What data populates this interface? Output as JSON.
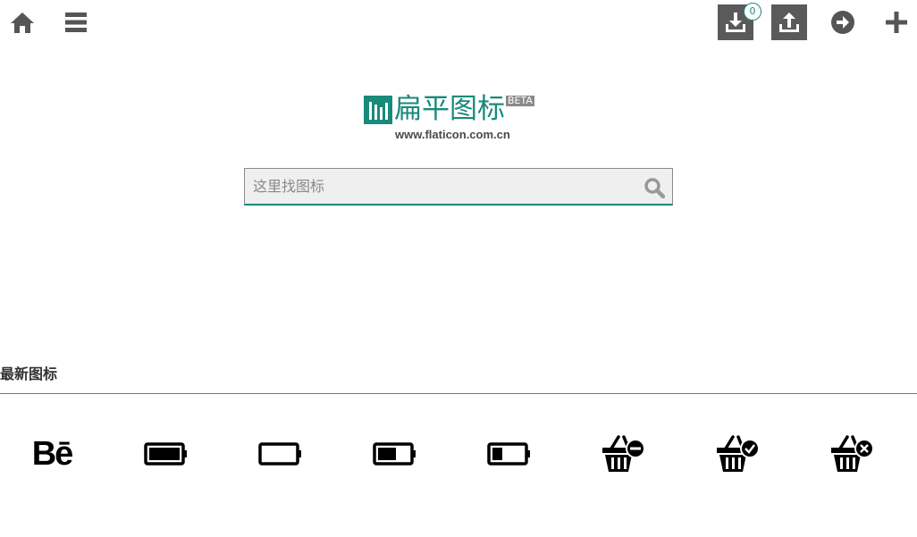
{
  "topbar": {
    "home_icon": "home-icon",
    "menu_icon": "menu-icon",
    "download_icon": "download-icon",
    "download_count": "0",
    "upload_icon": "upload-icon",
    "login_icon": "arrow-right-circle-icon",
    "add_icon": "plus-icon"
  },
  "logo": {
    "text": "扁平图标",
    "beta": "BETA",
    "url": "www.flaticon.com.cn"
  },
  "search": {
    "placeholder": "这里找图标",
    "value": ""
  },
  "latest": {
    "title": "最新图标",
    "icons": [
      {
        "name": "behance-icon",
        "text": "Bē"
      },
      {
        "name": "battery-full-icon",
        "level": 1.0
      },
      {
        "name": "battery-empty-icon",
        "level": 0.0
      },
      {
        "name": "battery-half-icon",
        "level": 0.5
      },
      {
        "name": "battery-low-icon",
        "level": 0.25
      },
      {
        "name": "basket-remove-icon"
      },
      {
        "name": "basket-check-icon"
      },
      {
        "name": "basket-delete-icon"
      }
    ]
  },
  "colors": {
    "brand": "#1a8a7a",
    "dark_button": "#5a5a5a",
    "icon_gray": "#555555"
  }
}
